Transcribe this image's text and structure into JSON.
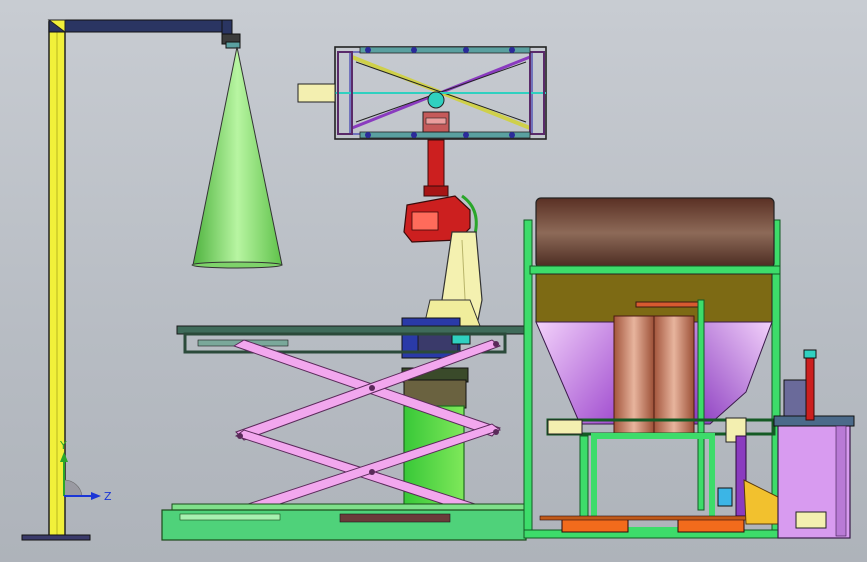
{
  "viewport": {
    "background_top": "#c8ccd2",
    "background_bottom": "#aeb3ba"
  },
  "triad": {
    "x_label": "",
    "y_label": "Y",
    "z_label": "Z",
    "y_color": "#2aa62a",
    "z_color": "#1b36d6"
  },
  "colors": {
    "gantry_yellow": "#f1f03a",
    "cone_green": "#8fe07a",
    "frame_green": "#3ddc6a",
    "scissor_pink": "#f2a7ee",
    "robot_yellow": "#f4f1b0",
    "robot_red": "#cc1f1f",
    "drum_brown": "#7a4a3a",
    "hopper_violet": "#c97be6",
    "tank_olive": "#7d6a14",
    "pipe_copper": "#c9826a",
    "cabinet_violet": "#d89bf0",
    "base_orange": "#f26b1c"
  }
}
